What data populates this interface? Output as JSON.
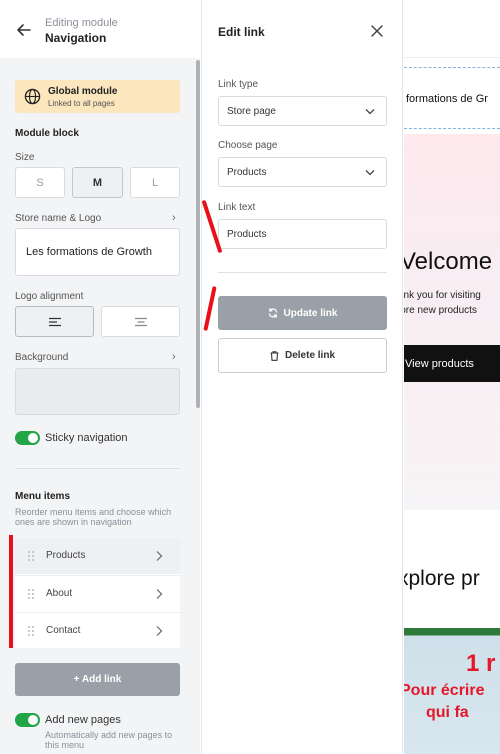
{
  "editor": {
    "header": {
      "subtitle": "Editing module",
      "title": "Navigation"
    },
    "global_module": {
      "title": "Global module",
      "subtitle": "Linked to all pages"
    },
    "module_block": {
      "title": "Module block",
      "size_label": "Size",
      "sizes": [
        "S",
        "M",
        "L"
      ],
      "selected_size": "M",
      "store_label": "Store name & Logo",
      "store_value": "Les formations de Growth",
      "logo_alignment_label": "Logo alignment",
      "selected_alignment": "left",
      "background_label": "Background",
      "sticky_label": "Sticky navigation",
      "sticky_on": true
    },
    "menu": {
      "title": "Menu items",
      "subtitle": "Reorder menu items and choose which ones are shown in navigation",
      "items": [
        {
          "label": "Products",
          "selected": true
        },
        {
          "label": "About",
          "selected": false
        },
        {
          "label": "Contact",
          "selected": false
        }
      ],
      "add_link_label": "+ Add link",
      "new_pages_label": "Add new pages",
      "new_pages_sub": "Automatically add new pages to this menu",
      "new_pages_on": true
    }
  },
  "link_panel": {
    "title": "Edit link",
    "link_type_label": "Link type",
    "link_type_value": "Store page",
    "choose_page_label": "Choose page",
    "choose_page_value": "Products",
    "link_text_label": "Link text",
    "link_text_value": "Products",
    "update_label": "Update link",
    "delete_label": "Delete link"
  },
  "preview": {
    "nav_text": "formations de Gr",
    "hero_title": "Velcome",
    "hero_line1": "ank you for visiting",
    "hero_line2": "lore new products",
    "hero_button": "View products",
    "section_title": "xplore pr",
    "image_text_big": "1 r",
    "image_text_line2": "Pour écrire",
    "image_text_line3": "qui fa"
  },
  "colors": {
    "accent_green": "#22a447",
    "annotation_red": "#e8101a",
    "global_banner": "#fbe6bd",
    "disabled_button": "#9aa0a7"
  }
}
